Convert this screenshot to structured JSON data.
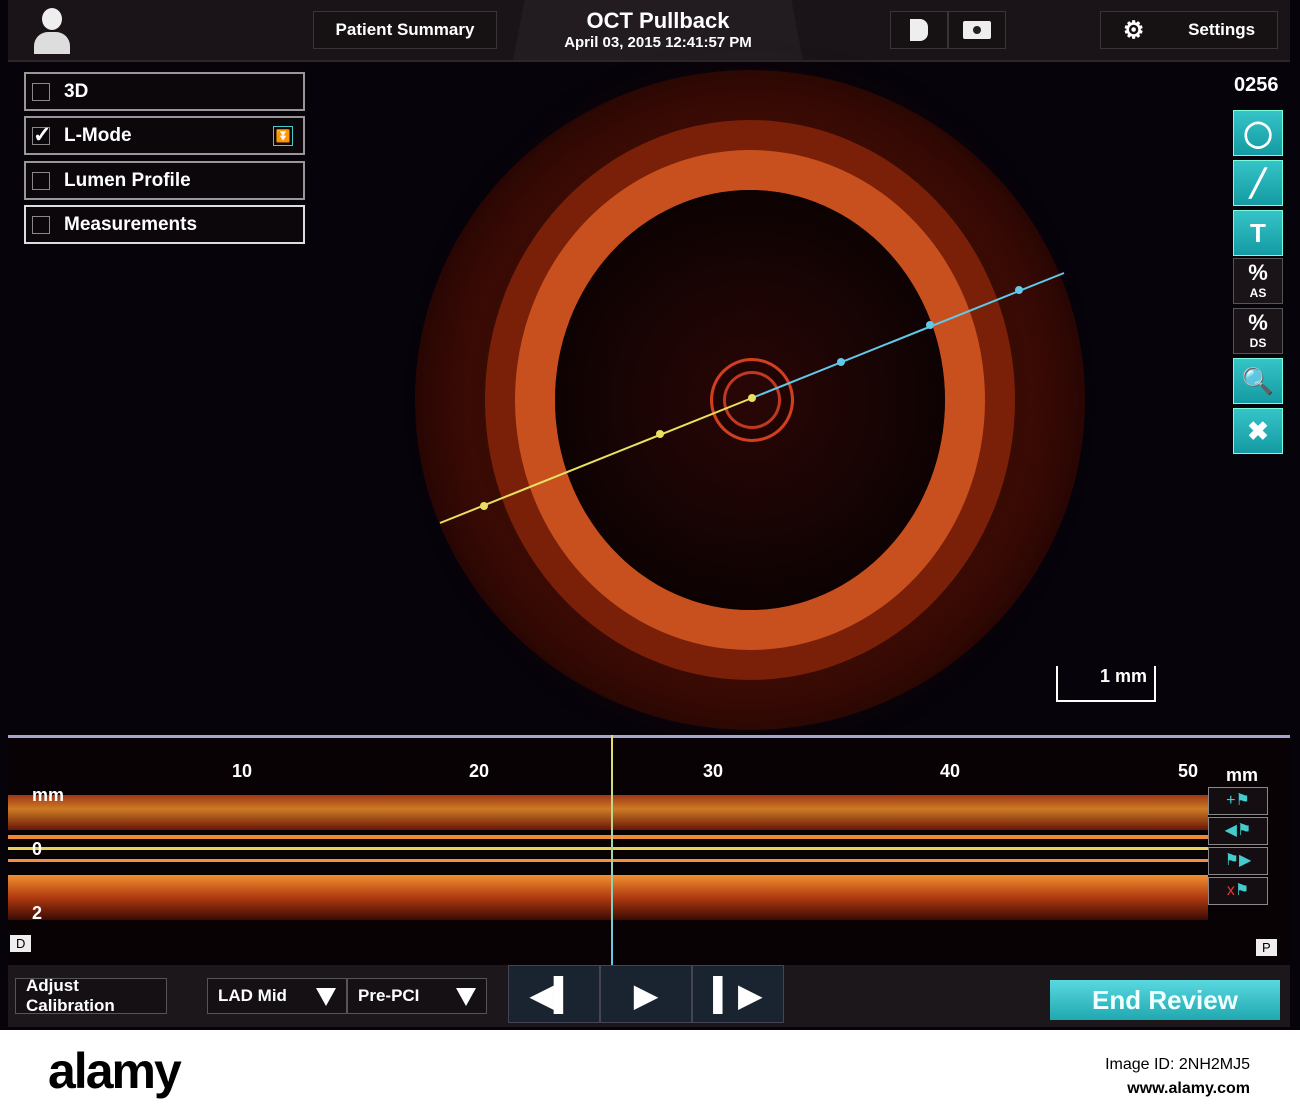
{
  "header": {
    "patient_summary": "Patient Summary",
    "title": "OCT Pullback",
    "datetime": "April 03, 2015 12:41:57 PM",
    "settings": "Settings"
  },
  "options": [
    {
      "label": "3D",
      "checked": false
    },
    {
      "label": "L-Mode",
      "checked": true
    },
    {
      "label": "Lumen Profile",
      "checked": false
    },
    {
      "label": "Measurements",
      "checked": false
    }
  ],
  "frame_number": "0256",
  "tools": {
    "area_pct": "%",
    "area_sub": "AS",
    "diam_pct": "%",
    "diam_sub": "DS",
    "text": "T"
  },
  "scale_label": "1 mm",
  "lmode": {
    "ticks": [
      "10",
      "20",
      "30",
      "40",
      "50"
    ],
    "unit": "mm",
    "left_unit": "mm",
    "y0": "0",
    "y2": "2",
    "distal": "D",
    "proximal": "P"
  },
  "bottom": {
    "adjust_calibration": "Adjust Calibration",
    "segment": "LAD Mid",
    "stage": "Pre-PCI",
    "end_review": "End Review"
  },
  "footer": {
    "brand": "alamy",
    "image_id": "Image ID: 2NH2MJ5",
    "url": "www.alamy.com"
  }
}
